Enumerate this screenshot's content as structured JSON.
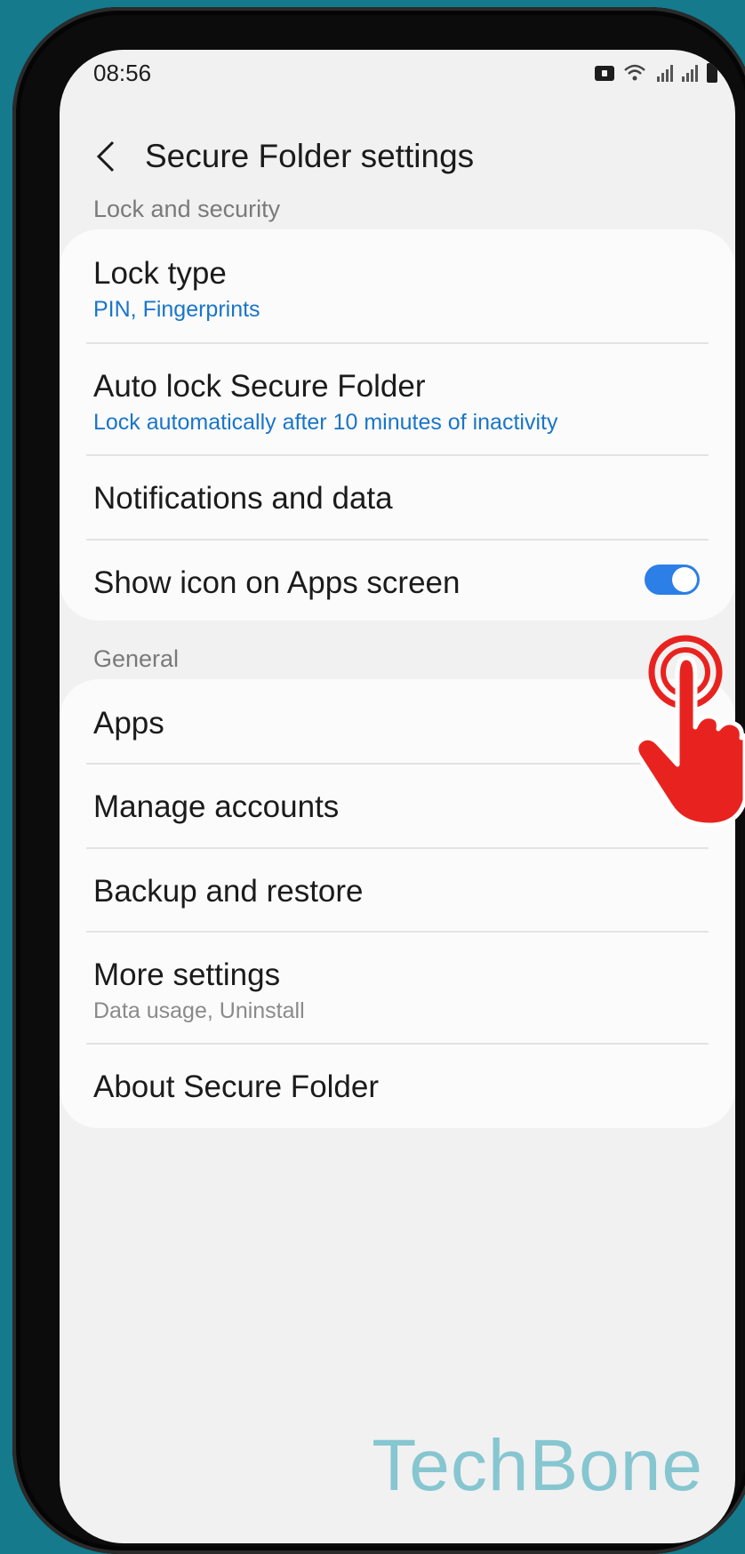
{
  "status_bar": {
    "time": "08:56",
    "icons": [
      "secure-folder-icon",
      "wifi-icon",
      "signal-icon",
      "signal-icon",
      "battery-icon"
    ]
  },
  "app_bar": {
    "title": "Secure Folder settings",
    "back_icon": "chevron-left-icon"
  },
  "sections": {
    "lock_security": {
      "label": "Lock and security",
      "items": {
        "lock_type": {
          "title": "Lock type",
          "subtitle": "PIN, Fingerprints"
        },
        "auto_lock": {
          "title": "Auto lock Secure Folder",
          "subtitle": "Lock automatically after 10 minutes of inactivity"
        },
        "notifications": {
          "title": "Notifications and data"
        },
        "show_icon": {
          "title": "Show icon on Apps screen",
          "toggle_on": true
        }
      }
    },
    "general": {
      "label": "General",
      "items": {
        "apps": {
          "title": "Apps"
        },
        "manage_accounts": {
          "title": "Manage accounts"
        },
        "backup_restore": {
          "title": "Backup and restore"
        },
        "more_settings": {
          "title": "More settings",
          "subtitle": "Data usage, Uninstall"
        },
        "about": {
          "title": "About Secure Folder"
        }
      }
    }
  },
  "watermark": "TechBone",
  "colors": {
    "background": "#147a8c",
    "accent": "#1a75c9",
    "toggle": "#2b7fe6",
    "hand": "#e8231f",
    "watermark": "#86c6d0"
  }
}
